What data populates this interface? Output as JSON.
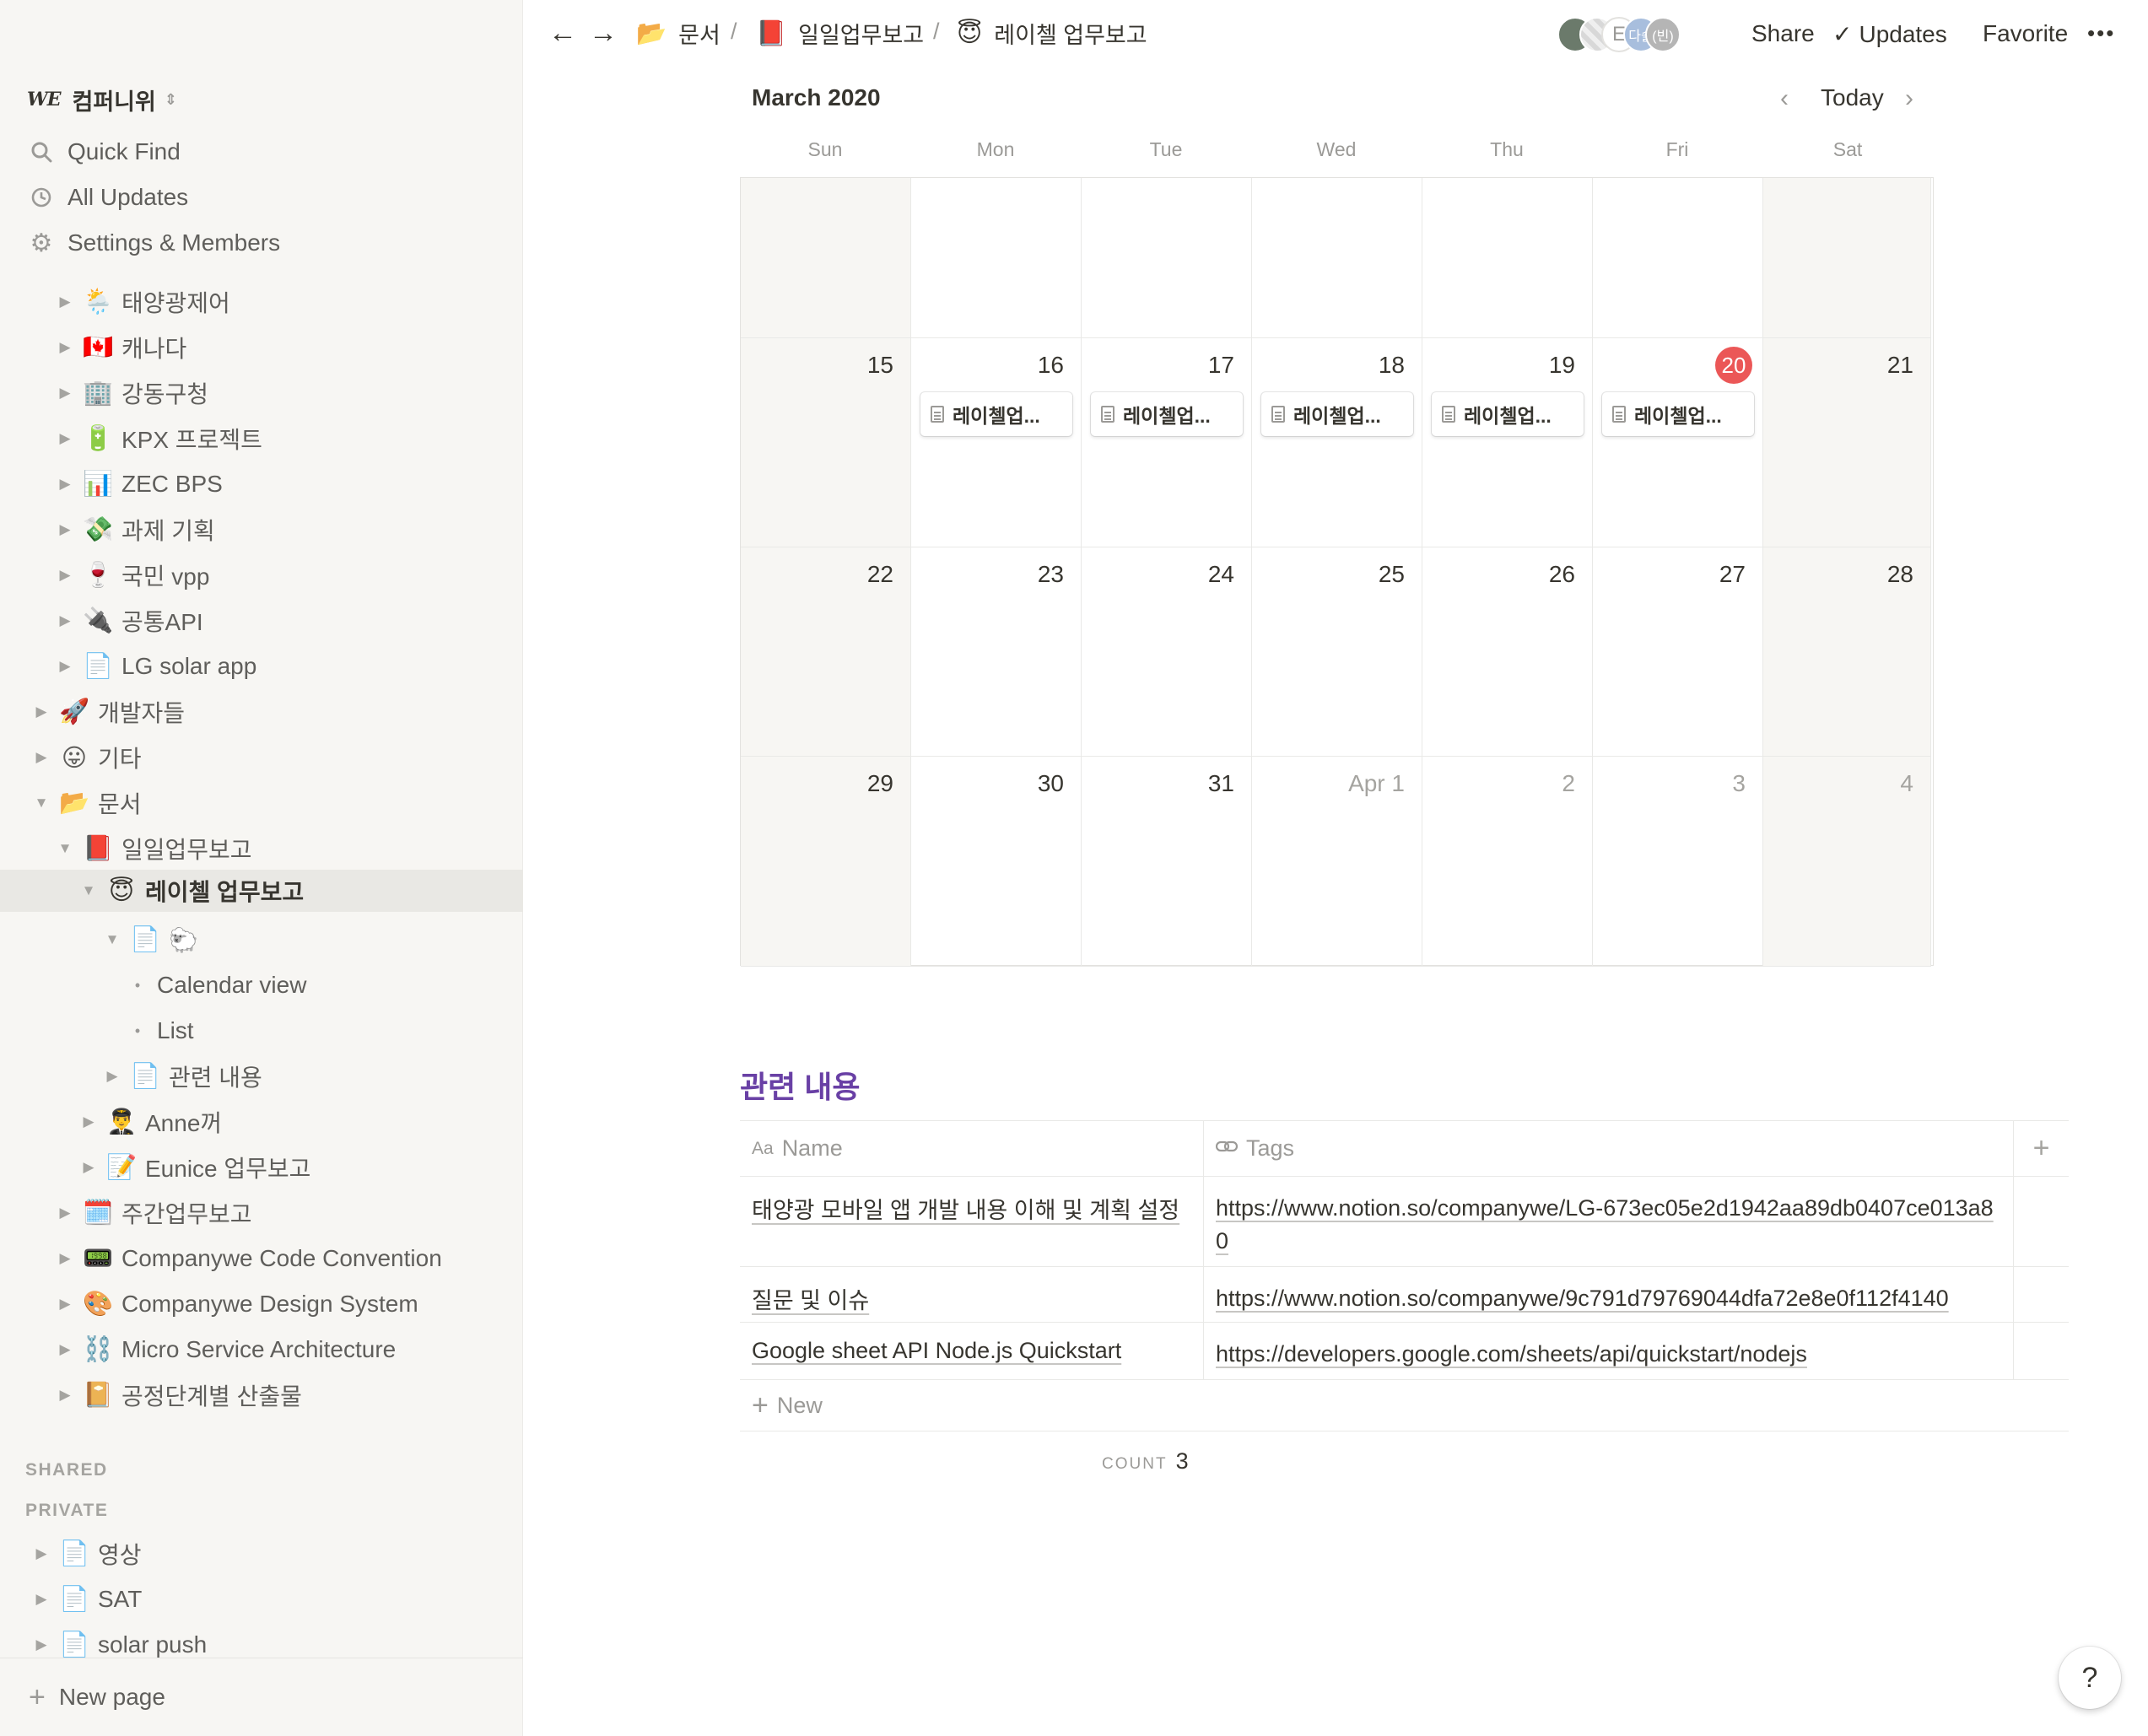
{
  "workspace": {
    "logo": "WE",
    "name": "컴퍼니위"
  },
  "sidebar_nav": [
    {
      "label": "Quick Find",
      "icon": "search-icon"
    },
    {
      "label": "All Updates",
      "icon": "clock-icon"
    },
    {
      "label": "Settings & Members",
      "icon": "gear-icon"
    }
  ],
  "tree": [
    {
      "emoji": "🌦️",
      "label": "태양광제어",
      "toggle": "▶"
    },
    {
      "emoji": "🇨🇦",
      "label": "캐나다",
      "toggle": "▶"
    },
    {
      "emoji": "🏢",
      "label": "강동구청",
      "toggle": "▶"
    },
    {
      "emoji": "🔋",
      "label": "KPX 프로젝트",
      "toggle": "▶"
    },
    {
      "emoji": "📊",
      "label": "ZEC BPS",
      "toggle": "▶"
    },
    {
      "emoji": "💸",
      "label": "과제 기획",
      "toggle": "▶"
    },
    {
      "emoji": "🍷",
      "label": "국민 vpp",
      "toggle": "▶"
    },
    {
      "emoji": "🔌",
      "label": "공통API",
      "toggle": "▶"
    },
    {
      "emoji": "📄",
      "label": "LG solar app",
      "toggle": "▶"
    },
    {
      "emoji": "🚀",
      "label": "개발자들",
      "toggle": "▶"
    },
    {
      "emoji": "😛",
      "label": "기타",
      "toggle": "▶"
    },
    {
      "emoji": "📂",
      "label": "문서",
      "toggle": "▼"
    },
    {
      "emoji": "📕",
      "label": "일일업무보고",
      "toggle": "▼"
    },
    {
      "emoji": "😇",
      "label": "레이첼 업무보고",
      "toggle": "▼"
    },
    {
      "emoji": "📄",
      "label": "🐑",
      "toggle": "▼"
    },
    {
      "emoji": "",
      "label": "Calendar view",
      "toggle": "•"
    },
    {
      "emoji": "",
      "label": "List",
      "toggle": "•"
    },
    {
      "emoji": "📄",
      "label": "관련 내용",
      "toggle": "▶"
    },
    {
      "emoji": "👨‍✈️",
      "label": "Anne꺼",
      "toggle": "▶"
    },
    {
      "emoji": "📝",
      "label": "Eunice 업무보고",
      "toggle": "▶"
    },
    {
      "emoji": "🗓️",
      "label": "주간업무보고",
      "toggle": "▶"
    },
    {
      "emoji": "📟",
      "label": "Companywe Code Convention",
      "toggle": "▶"
    },
    {
      "emoji": "🎨",
      "label": "Companywe Design System",
      "toggle": "▶"
    },
    {
      "emoji": "⛓️",
      "label": "Micro Service Architecture",
      "toggle": "▶"
    },
    {
      "emoji": "📔",
      "label": "공정단계별 산출물",
      "toggle": "▶"
    }
  ],
  "sections": {
    "shared": "SHARED",
    "private": "PRIVATE"
  },
  "private_tree": [
    {
      "emoji": "📄",
      "label": "영상",
      "toggle": "▶"
    },
    {
      "emoji": "📄",
      "label": "SAT",
      "toggle": "▶"
    },
    {
      "emoji": "📄",
      "label": "solar push",
      "toggle": "▶"
    }
  ],
  "new_page": "New page",
  "breadcrumb": [
    {
      "emoji": "📂",
      "label": "문서"
    },
    {
      "emoji": "📕",
      "label": "일일업무보고"
    },
    {
      "emoji": "😇",
      "label": "레이첼 업무보고"
    }
  ],
  "breadcrumb_sep": "/",
  "avatars": [
    {
      "text": "",
      "color": "#6b7a6b"
    },
    {
      "text": "",
      "color": "#c9c9c9"
    },
    {
      "text": "E",
      "color": "#ffffff"
    },
    {
      "text": "다솔",
      "color": "#a8bedd"
    },
    {
      "text": "(빈)",
      "color": "#b5b5b5"
    }
  ],
  "top_actions": {
    "share": "Share",
    "updates": "Updates",
    "favorite": "Favorite",
    "more": "•••"
  },
  "calendar": {
    "month": "March 2020",
    "today_label": "Today",
    "weekdays": [
      "Sun",
      "Mon",
      "Tue",
      "Wed",
      "Thu",
      "Fri",
      "Sat"
    ],
    "weeks": [
      [
        {
          "d": ""
        },
        {
          "d": ""
        },
        {
          "d": ""
        },
        {
          "d": ""
        },
        {
          "d": ""
        },
        {
          "d": ""
        },
        {
          "d": ""
        }
      ],
      [
        {
          "d": "15"
        },
        {
          "d": "16",
          "ev": "레이첼업..."
        },
        {
          "d": "17",
          "ev": "레이첼업..."
        },
        {
          "d": "18",
          "ev": "레이첼업..."
        },
        {
          "d": "19",
          "ev": "레이첼업..."
        },
        {
          "d": "20",
          "ev": "레이첼업...",
          "today": true
        },
        {
          "d": "21"
        }
      ],
      [
        {
          "d": "22"
        },
        {
          "d": "23"
        },
        {
          "d": "24"
        },
        {
          "d": "25"
        },
        {
          "d": "26"
        },
        {
          "d": "27"
        },
        {
          "d": "28"
        }
      ],
      [
        {
          "d": "29"
        },
        {
          "d": "30"
        },
        {
          "d": "31"
        },
        {
          "d": "Apr 1",
          "muted": true
        },
        {
          "d": "2",
          "muted": true
        },
        {
          "d": "3",
          "muted": true
        },
        {
          "d": "4",
          "muted": true
        }
      ]
    ],
    "today_color": "#eb5757"
  },
  "related": {
    "title": "관련 내용",
    "title_color": "#6940a5",
    "columns": {
      "name": "Name",
      "name_icon": "Aa",
      "tags": "Tags",
      "tags_icon": "link-icon"
    },
    "rows": [
      {
        "name": "태양광 모바일 앱 개발 내용 이해 및 계획 설정",
        "tags": "https://www.notion.so/companywe/LG-673ec05e2d1942aa89db0407ce013a80"
      },
      {
        "name": "질문 및 이슈",
        "tags": "https://www.notion.so/companywe/9c791d79769044dfa72e8e0f112f4140"
      },
      {
        "name": "Google sheet API Node.js Quickstart",
        "tags": "https://developers.google.com/sheets/api/quickstart/nodejs"
      }
    ],
    "new_label": "New",
    "count_label": "COUNT",
    "count_value": "3"
  },
  "help": "?"
}
